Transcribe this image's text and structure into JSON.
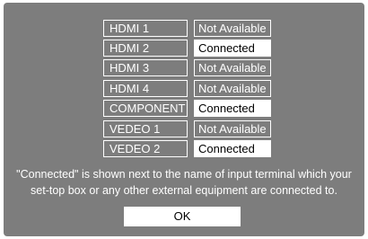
{
  "inputs": [
    {
      "name": "HDMI 1",
      "status": "Not Available",
      "connected": false
    },
    {
      "name": "HDMI 2",
      "status": "Connected",
      "connected": true
    },
    {
      "name": "HDMI 3",
      "status": "Not Available",
      "connected": false
    },
    {
      "name": "HDMI 4",
      "status": "Not Available",
      "connected": false
    },
    {
      "name": "COMPONENT",
      "status": "Connected",
      "connected": true
    },
    {
      "name": "VEDEO 1",
      "status": "Not Available",
      "connected": false
    },
    {
      "name": "VEDEO 2",
      "status": "Connected",
      "connected": true
    }
  ],
  "note": {
    "line1": "\"Connected\" is shown next to the name of input terminal which your",
    "line2": "set-top box or any other external equipment are connected to."
  },
  "ok_label": "OK",
  "colors": {
    "panel": "#7d7d7d",
    "text_light": "#ffffff",
    "connected_bg": "#ffffff",
    "connected_text": "#000000"
  }
}
